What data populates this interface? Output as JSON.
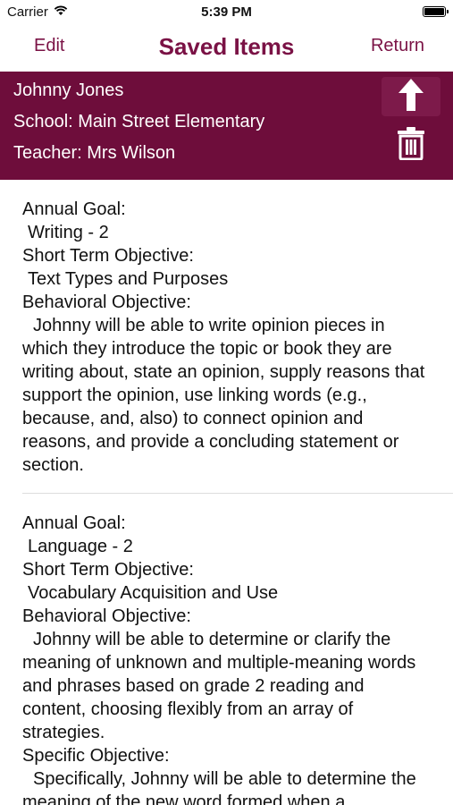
{
  "status_bar": {
    "carrier": "Carrier",
    "time": "5:39 PM"
  },
  "nav": {
    "edit": "Edit",
    "title": "Saved Items",
    "return": "Return"
  },
  "student": {
    "name": "Johnny Jones",
    "school": "School: Main Street Elementary",
    "teacher": "Teacher: Mrs Wilson"
  },
  "colors": {
    "brand": "#6e0d3b",
    "nav_text": "#7a1245"
  },
  "items": [
    {
      "annual_goal_label": "Annual Goal:",
      "annual_goal": "Writing - 2",
      "short_term_label": "Short Term Objective:",
      "short_term": "Text Types and Purposes",
      "behavioral_label": "Behavioral Objective:",
      "behavioral": "Johnny will be able to write opinion pieces in which they introduce the topic or book they are writing about, state an opinion, supply reasons that support the opinion, use linking words (e.g., because, and, also) to connect opinion and reasons, and provide a concluding statement or section."
    },
    {
      "annual_goal_label": "Annual Goal:",
      "annual_goal": "Language - 2",
      "short_term_label": "Short Term Objective:",
      "short_term": "Vocabulary Acquisition and Use",
      "behavioral_label": "Behavioral Objective:",
      "behavioral": "Johnny will be able to determine or clarify the meaning of unknown and multiple-meaning words and phrases based on grade 2 reading and content, choosing flexibly from an array of strategies.",
      "specific_label": "Specific Objective:",
      "specific": "Specifically, Johnny will be able to determine the meaning of the new word formed when a"
    }
  ]
}
